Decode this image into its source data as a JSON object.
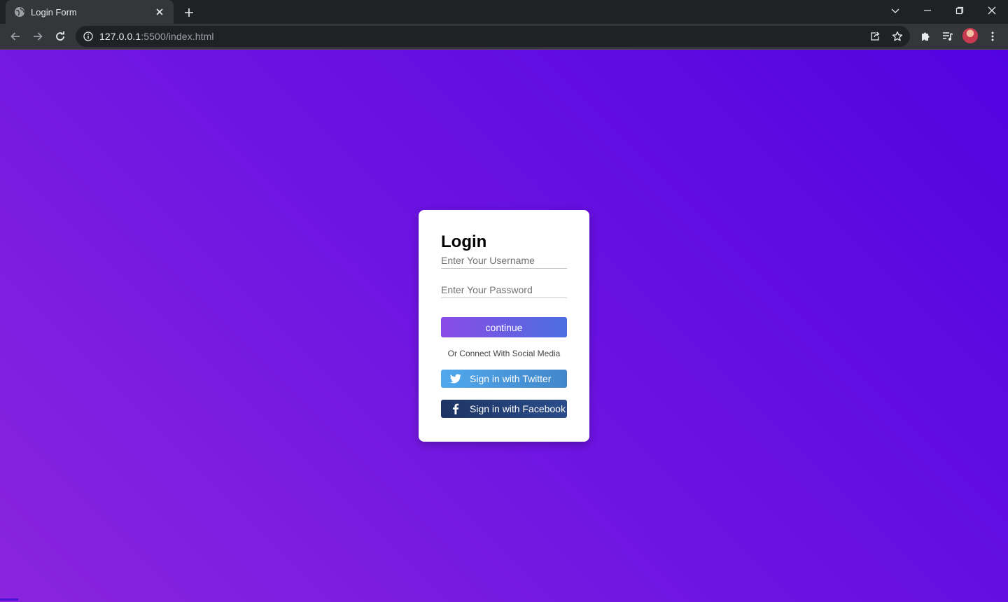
{
  "browser": {
    "tab_title": "Login Form",
    "url_host": "127.0.0.1",
    "url_rest": ":5500/index.html",
    "icons": {
      "favicon": "globe-icon",
      "tab_close": "close-icon",
      "new_tab": "plus-icon",
      "back": "arrow-left-icon",
      "forward": "arrow-right-icon",
      "reload": "reload-icon",
      "site_info": "info-icon",
      "share": "share-icon",
      "bookmark": "star-icon",
      "extensions": "puzzle-icon",
      "media": "playlist-icon",
      "menu": "kebab-menu-icon"
    }
  },
  "page": {
    "background_colors": [
      "#5203e0",
      "#8a25de"
    ],
    "login": {
      "title": "Login",
      "username_placeholder": "Enter Your Username",
      "password_placeholder": "Enter Your Password",
      "continue_label": "continue",
      "social_text": "Or Connect With Social Media",
      "twitter_label": "Sign in with Twitter",
      "facebook_label": "Sign in with Facebook"
    }
  }
}
